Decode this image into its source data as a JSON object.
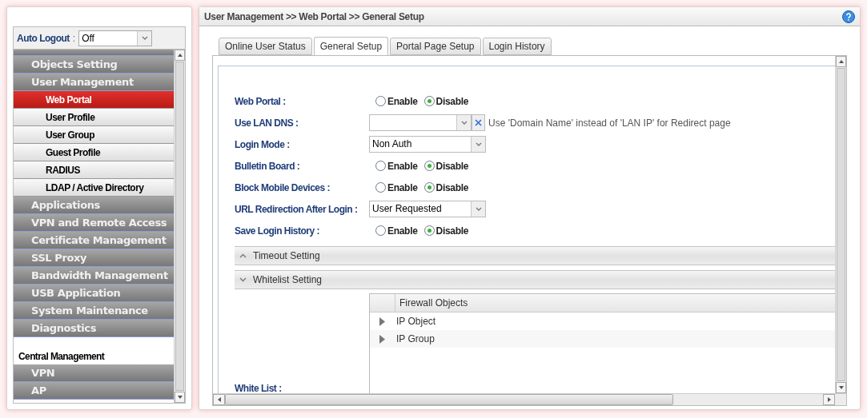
{
  "sidebar": {
    "auto_logout": {
      "label": "Auto Logout",
      "colon": ":",
      "value": "Off"
    },
    "items": [
      {
        "kind": "group",
        "label": "Objects Setting"
      },
      {
        "kind": "group",
        "label": "User Management"
      },
      {
        "kind": "sub",
        "label": "Web Portal",
        "selected": true
      },
      {
        "kind": "sub",
        "label": "User Profile",
        "selected": false
      },
      {
        "kind": "sub",
        "label": "User Group",
        "selected": false
      },
      {
        "kind": "sub",
        "label": "Guest Profile",
        "selected": false
      },
      {
        "kind": "sub",
        "label": "RADIUS",
        "selected": false
      },
      {
        "kind": "sub",
        "label": "LDAP / Active Directory",
        "selected": false
      },
      {
        "kind": "group",
        "label": "Applications"
      },
      {
        "kind": "group",
        "label": "VPN and Remote Access"
      },
      {
        "kind": "group",
        "label": "Certificate Management"
      },
      {
        "kind": "group",
        "label": "SSL Proxy"
      },
      {
        "kind": "group",
        "label": "Bandwidth Management"
      },
      {
        "kind": "group",
        "label": "USB Application"
      },
      {
        "kind": "group",
        "label": "System Maintenance"
      },
      {
        "kind": "group",
        "label": "Diagnostics"
      },
      {
        "kind": "section",
        "label": "Central Management"
      },
      {
        "kind": "group",
        "label": "VPN"
      },
      {
        "kind": "group",
        "label": "AP"
      }
    ]
  },
  "breadcrumb": "User Management >> Web Portal >> General Setup",
  "tabs": [
    {
      "label": "Online User Status",
      "selected": false
    },
    {
      "label": "General Setup",
      "selected": true
    },
    {
      "label": "Portal Page Setup",
      "selected": false
    },
    {
      "label": "Login History",
      "selected": false
    }
  ],
  "form": [
    {
      "kind": "radio",
      "label": "Web Portal :",
      "options": [
        {
          "label": "Enable",
          "selected": false
        },
        {
          "label": "Disable",
          "selected": true
        }
      ]
    },
    {
      "kind": "combo",
      "label": "Use LAN DNS :",
      "note": "Use 'Domain Name' instead of 'LAN IP' for Redirect page"
    },
    {
      "kind": "select",
      "label": "Login Mode :",
      "value": "Non Auth"
    },
    {
      "kind": "radio",
      "label": "Bulletin Board :",
      "options": [
        {
          "label": "Enable",
          "selected": false
        },
        {
          "label": "Disable",
          "selected": true
        }
      ]
    },
    {
      "kind": "radio",
      "label": "Block Mobile Devices :",
      "options": [
        {
          "label": "Enable",
          "selected": false
        },
        {
          "label": "Disable",
          "selected": true
        }
      ]
    },
    {
      "kind": "select",
      "label": "URL Redirection After Login :",
      "value": "User Requested"
    },
    {
      "kind": "radio",
      "label": "Save Login History :",
      "options": [
        {
          "label": "Enable",
          "selected": false
        },
        {
          "label": "Disable",
          "selected": true
        }
      ]
    }
  ],
  "sections": [
    {
      "label": "Timeout Setting",
      "expanded": false
    },
    {
      "label": "Whitelist Setting",
      "expanded": true
    }
  ],
  "whitelist": {
    "label": "White List :",
    "column": "Firewall Objects",
    "rows": [
      "IP Object",
      "IP Group"
    ]
  }
}
